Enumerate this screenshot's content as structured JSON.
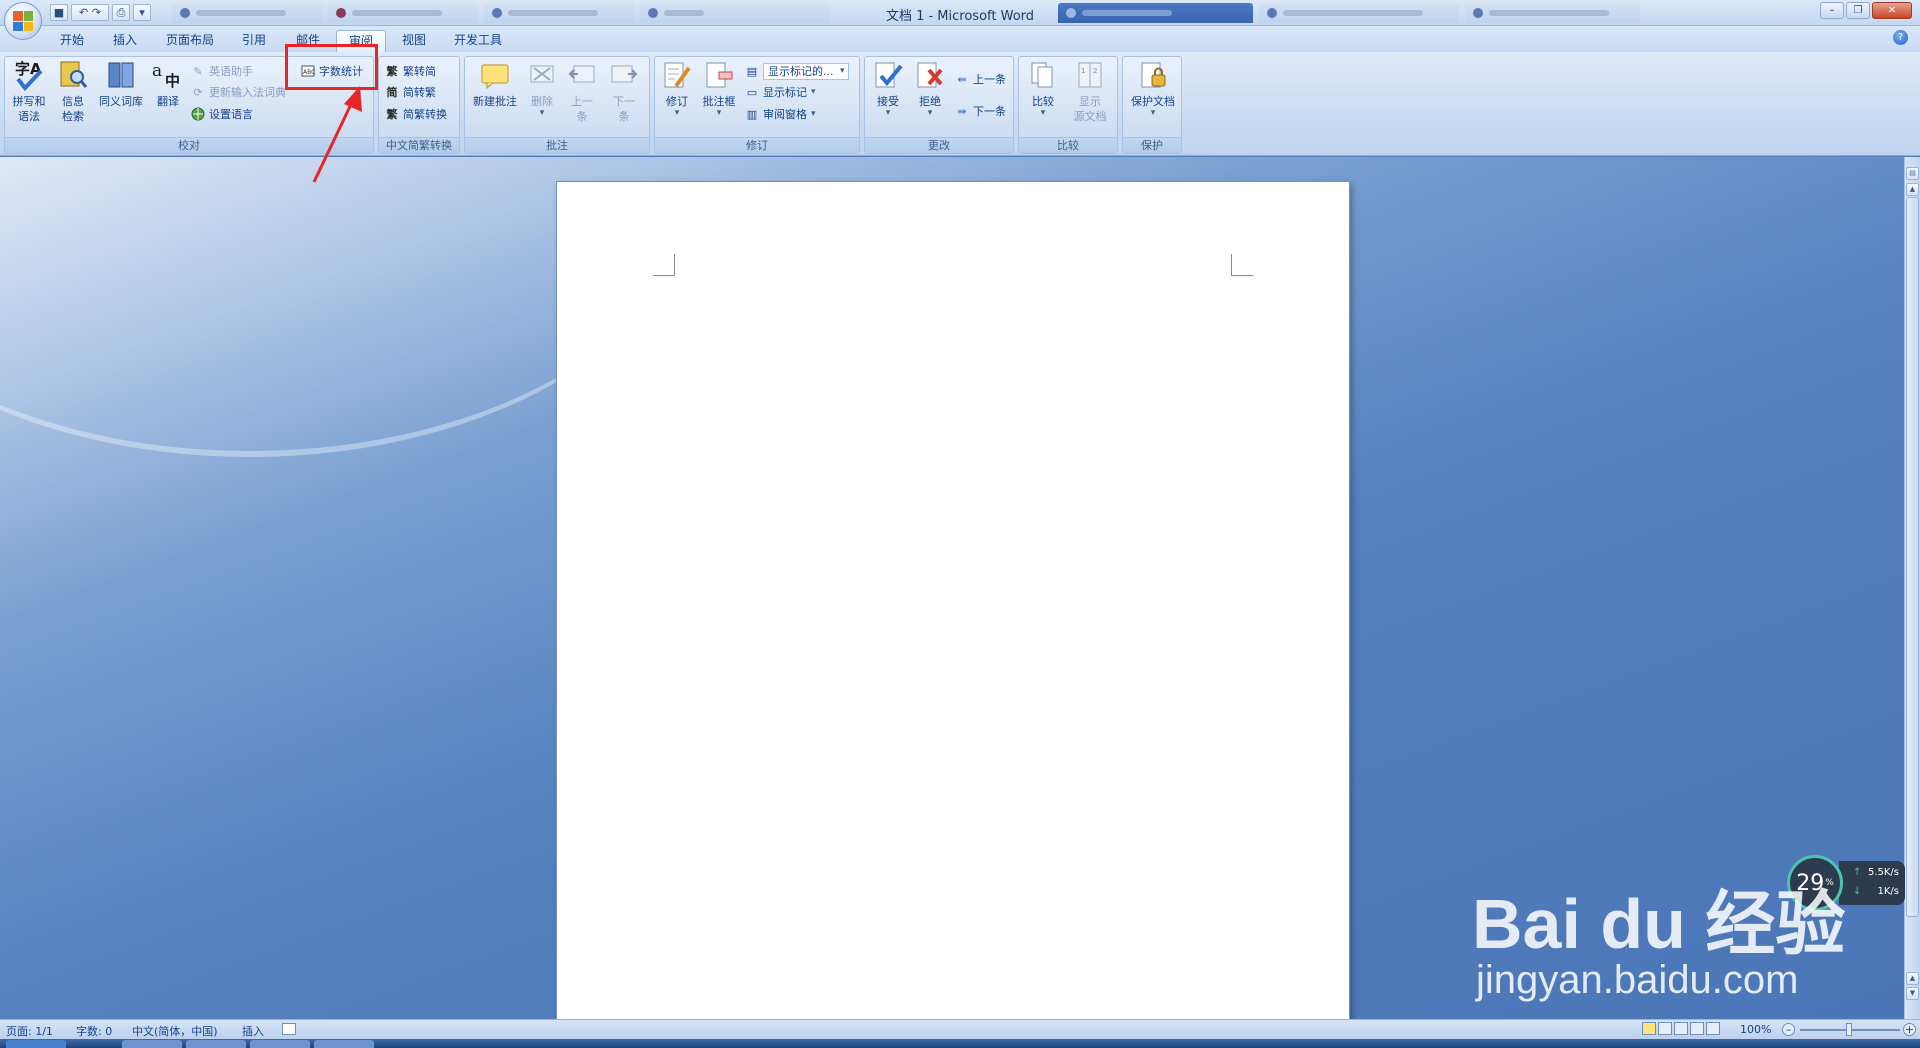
{
  "window": {
    "title": "文档 1 - Microsoft Word"
  },
  "quick_access": {
    "undo_redo": "↶ ↷",
    "menu_caret": "▾"
  },
  "tabs": [
    "开始",
    "插入",
    "页面布局",
    "引用",
    "邮件",
    "审阅",
    "视图",
    "开发工具"
  ],
  "active_tab": "审阅",
  "groups": {
    "proofing": "校对",
    "chinese_conversion": "中文简繁转换",
    "comments": "批注",
    "tracking": "修订",
    "changes": "更改",
    "compare": "比较",
    "protect": "保护"
  },
  "buttons": {
    "spelling": [
      "拼写和",
      "语法"
    ],
    "research": [
      "信息",
      "检索"
    ],
    "thesaurus": "同义词库",
    "translate": "翻译",
    "english_assistant": "英语助手",
    "update_ime": "更新输入法词典",
    "set_language": "设置语言",
    "word_count": "字数统计",
    "trad_to_simp": "繁转简",
    "simp_to_trad": "简转繁",
    "conversion": "简繁转换",
    "new_comment": "新建批注",
    "delete": "删除",
    "previous": [
      "上一",
      "条"
    ],
    "next": [
      "下一",
      "条"
    ],
    "track_changes": "修订",
    "balloons": "批注框",
    "display_combo": "显示标记的...",
    "show_markup": "显示标记",
    "reviewing_pane": "审阅窗格",
    "accept": "接受",
    "reject": "拒绝",
    "prev_change": "上一条",
    "next_change": "下一条",
    "compare": "比较",
    "show_source": [
      "显示",
      "源文档"
    ],
    "protect_doc": "保护文档"
  },
  "status": {
    "page": "页面: 1/1",
    "words": "字数: 0",
    "language": "中文(简体，中国)",
    "mode": "插入",
    "zoom": "100%"
  },
  "overlay": {
    "cpu_percent": "29",
    "percent_sign": "%",
    "upload": "5.5K/s",
    "download": "1K/s",
    "watermark_logo": "Bai du 经验",
    "watermark_url": "jingyan.baidu.com"
  },
  "colors": {
    "ribbon_text": "#15428b",
    "annotation_red": "#e8262a",
    "speed_ring": "#4dc3ad"
  }
}
